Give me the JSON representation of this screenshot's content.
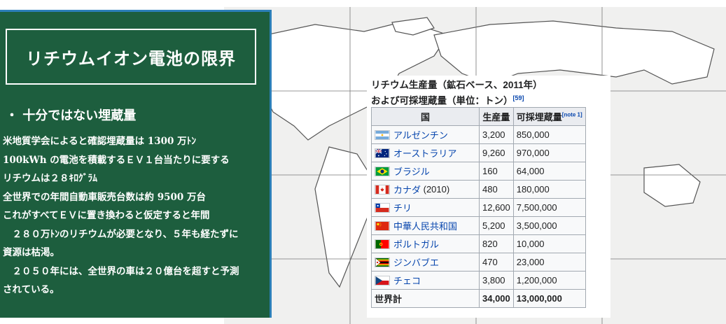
{
  "panel": {
    "title": "リチウムイオン電池の限界",
    "bullet": "・ 十分ではない埋蔵量",
    "lines": [
      "米地質学会によると確認埋蔵量は 1300 万ﾄﾝ",
      "100kWh の電池を積載するＥＶ１台当たりに要する",
      "リチウムは２８ｷﾛｸﾞﾗﾑ",
      "全世界での年間自動車販売台数は約 9500 万台",
      "これがすべてＥＶに置き換わると仮定すると年間",
      "　２８０万ﾄﾝのリチウムが必要となり、５年も経たずに",
      "資源は枯渇。",
      "　２０５０年には、全世界の車は２０億台を超すと予測",
      "されている。"
    ]
  },
  "table": {
    "caption_line1": "リチウム生産量（鉱石ベース、2011年）",
    "caption_line2": "および可採埋蔵量（単位：トン）",
    "caption_ref": "[59]",
    "headers": {
      "country": "国",
      "production": "生産量",
      "reserves": "可採埋蔵量",
      "note": "[note 1]"
    },
    "rows": [
      {
        "flag": "argentina-flag",
        "country": "アルゼンチン",
        "suffix": "",
        "production": "3,200",
        "reserves": "850,000"
      },
      {
        "flag": "australia-flag",
        "country": "オーストラリア",
        "suffix": "",
        "production": "9,260",
        "reserves": "970,000"
      },
      {
        "flag": "brazil-flag",
        "country": "ブラジル",
        "suffix": "",
        "production": "160",
        "reserves": "64,000"
      },
      {
        "flag": "canada-flag",
        "country": "カナダ",
        "suffix": " (2010)",
        "production": "480",
        "reserves": "180,000"
      },
      {
        "flag": "chile-flag",
        "country": "チリ",
        "suffix": "",
        "production": "12,600",
        "reserves": "7,500,000"
      },
      {
        "flag": "china-flag",
        "country": "中華人民共和国",
        "suffix": "",
        "production": "5,200",
        "reserves": "3,500,000"
      },
      {
        "flag": "portugal-flag",
        "country": "ポルトガル",
        "suffix": "",
        "production": "820",
        "reserves": "10,000"
      },
      {
        "flag": "zimbabwe-flag",
        "country": "ジンバブエ",
        "suffix": "",
        "production": "470",
        "reserves": "23,000"
      },
      {
        "flag": "czech-flag",
        "country": "チェコ",
        "suffix": "",
        "production": "3,800",
        "reserves": "1,200,000"
      }
    ],
    "total": {
      "label": "世界計",
      "production": "34,000",
      "reserves": "13,000,000"
    }
  },
  "colors": {
    "panel_bg": "#1d5e3e",
    "panel_border": "#2c7fb8",
    "link": "#0645ad"
  }
}
